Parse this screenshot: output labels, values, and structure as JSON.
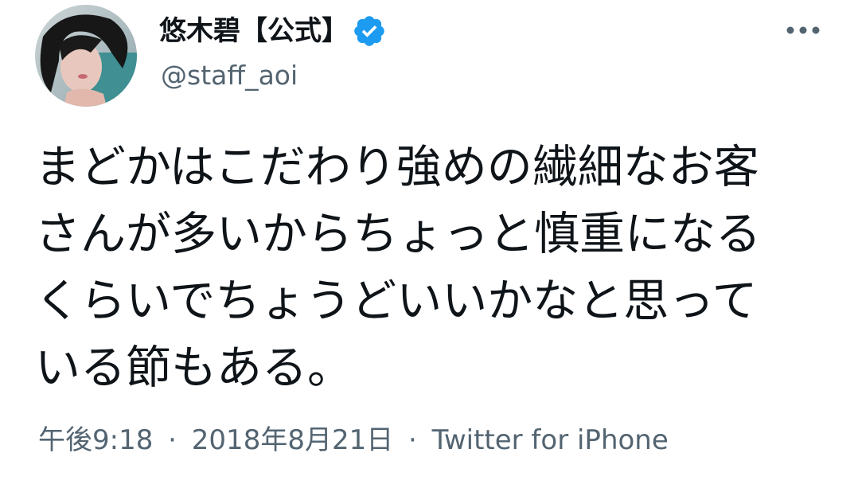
{
  "author": {
    "display_name": "悠木碧【公式】",
    "handle": "@staff_aoi",
    "verified": true,
    "avatar_icon": "user-avatar"
  },
  "more_icon": "more-horizontal-icon",
  "tweet": {
    "lines": [
      "まどかはこだわり強めの繊細なお客",
      "さんが多いからちょっと慎重になる",
      "くらいでちょうどいいかなと思って",
      "いる節もある。"
    ]
  },
  "meta": {
    "time": "午後9:18",
    "separator": "·",
    "date": "2018年8月21日",
    "source": "Twitter for iPhone"
  },
  "colors": {
    "text_primary": "#0f1419",
    "text_secondary": "#536471",
    "verified_blue": "#1d9bf0"
  }
}
